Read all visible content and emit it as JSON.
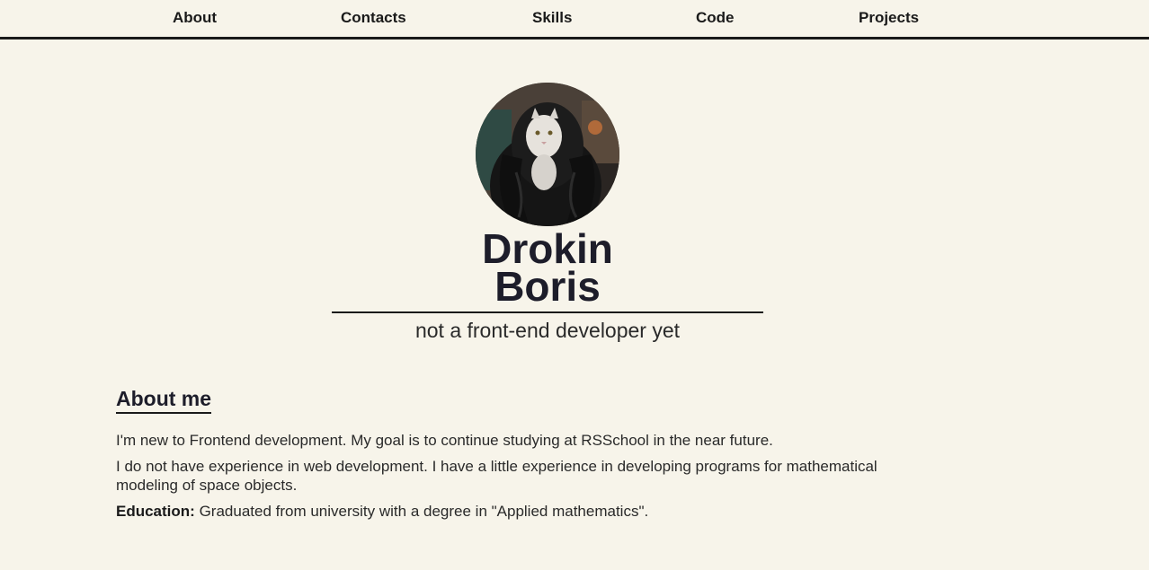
{
  "nav": {
    "items": [
      {
        "label": "About"
      },
      {
        "label": "Contacts"
      },
      {
        "label": "Skills"
      },
      {
        "label": "Code"
      },
      {
        "label": "Projects"
      }
    ]
  },
  "profile": {
    "photo_alt": "avatar-photo",
    "name_line1": "Drokin",
    "name_line2": "Boris",
    "tagline": "not a front-end developer yet"
  },
  "about": {
    "heading": "About me",
    "paragraph1": "I'm new to Frontend development. My goal is to continue studying at RSSchool in the near future.",
    "paragraph2": "I do not have experience in web development. I have a little experience in developing programs for mathematical modeling of space objects.",
    "education_label": "Education:",
    "education_text": " Graduated from university with a degree in \"Applied mathematics\"."
  },
  "colors": {
    "background": "#f7f4ea",
    "text": "#1d1d2a",
    "rule": "#1a1a1a"
  }
}
